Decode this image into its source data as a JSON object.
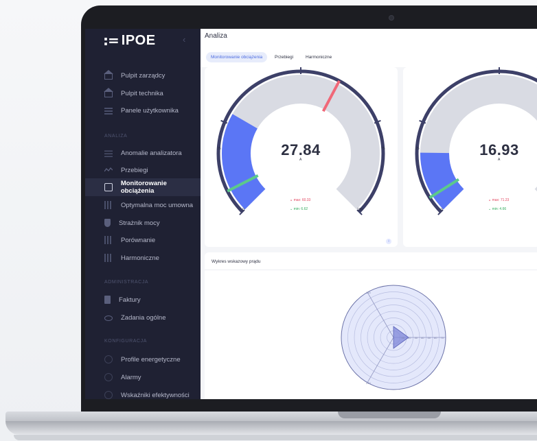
{
  "app": {
    "logo_mark": ":=",
    "logo_text": "IPOE",
    "collapse_icon": "chevron-left-icon"
  },
  "sidebar": {
    "items_top": [
      {
        "label": "Pulpit zarządcy",
        "icon": "home-icon"
      },
      {
        "label": "Pulpit technika",
        "icon": "home-icon"
      },
      {
        "label": "Panele użytkownika",
        "icon": "grid-icon"
      }
    ],
    "section_analiza": "ANALIZA",
    "items_analiza": [
      {
        "label": "Anomalie analizatora",
        "icon": "list-icon"
      },
      {
        "label": "Przebiegi",
        "icon": "wave-icon"
      },
      {
        "label": "Monitorowanie obciążenia",
        "icon": "monitor-icon"
      },
      {
        "label": "Optymalna moc umowna",
        "icon": "bars-icon"
      },
      {
        "label": "Strażnik mocy",
        "icon": "shield-icon"
      },
      {
        "label": "Porównanie",
        "icon": "bars-icon"
      },
      {
        "label": "Harmoniczne",
        "icon": "bars-icon"
      }
    ],
    "section_admin": "ADMINISTRACJA",
    "items_admin": [
      {
        "label": "Faktury",
        "icon": "document-icon"
      },
      {
        "label": "Zadania ogólne",
        "icon": "eye-icon"
      }
    ],
    "section_config": "KONFIGURACJA",
    "items_config": [
      {
        "label": "Profile energetyczne",
        "icon": "circle-icon"
      },
      {
        "label": "Alarmy",
        "icon": "circle-icon"
      },
      {
        "label": "Wskaźniki efektywności",
        "icon": "circle-icon"
      }
    ]
  },
  "header": {
    "title": "Analiza"
  },
  "tabs": [
    {
      "label": "Monitorowanie obciążenia",
      "active": true
    },
    {
      "label": "Przebiegi",
      "active": false
    },
    {
      "label": "Harmoniczne",
      "active": false
    }
  ],
  "gauges": [
    {
      "value": "27.84",
      "unit": "A",
      "level": 27.84,
      "min_label": "0",
      "max_label": "100",
      "tick25": "25",
      "tick75": "75",
      "max_text": "max: 60.33",
      "min_text": "min: 6.62",
      "max_marker": 60.33,
      "min_marker": 6.62
    },
    {
      "value": "16.93",
      "unit": "A",
      "level": 16.93,
      "min_label": "0",
      "tick25": "25",
      "max_text": "max: 71.23",
      "min_text": "min: 4.66",
      "max_marker": 71.23,
      "min_marker": 4.66
    }
  ],
  "info_label": "i",
  "chart": {
    "title": "Wykres wskazowy prądu",
    "radial_ticks": [
      "10",
      "20",
      "30",
      "40",
      "50",
      "60",
      "70"
    ],
    "angle_labels": [
      "120",
      "240"
    ]
  },
  "colors": {
    "accent": "#5b76f5",
    "track": "#d9dbe3",
    "rim": "#3d4068",
    "max": "#f06878",
    "min": "#5cc98b"
  }
}
